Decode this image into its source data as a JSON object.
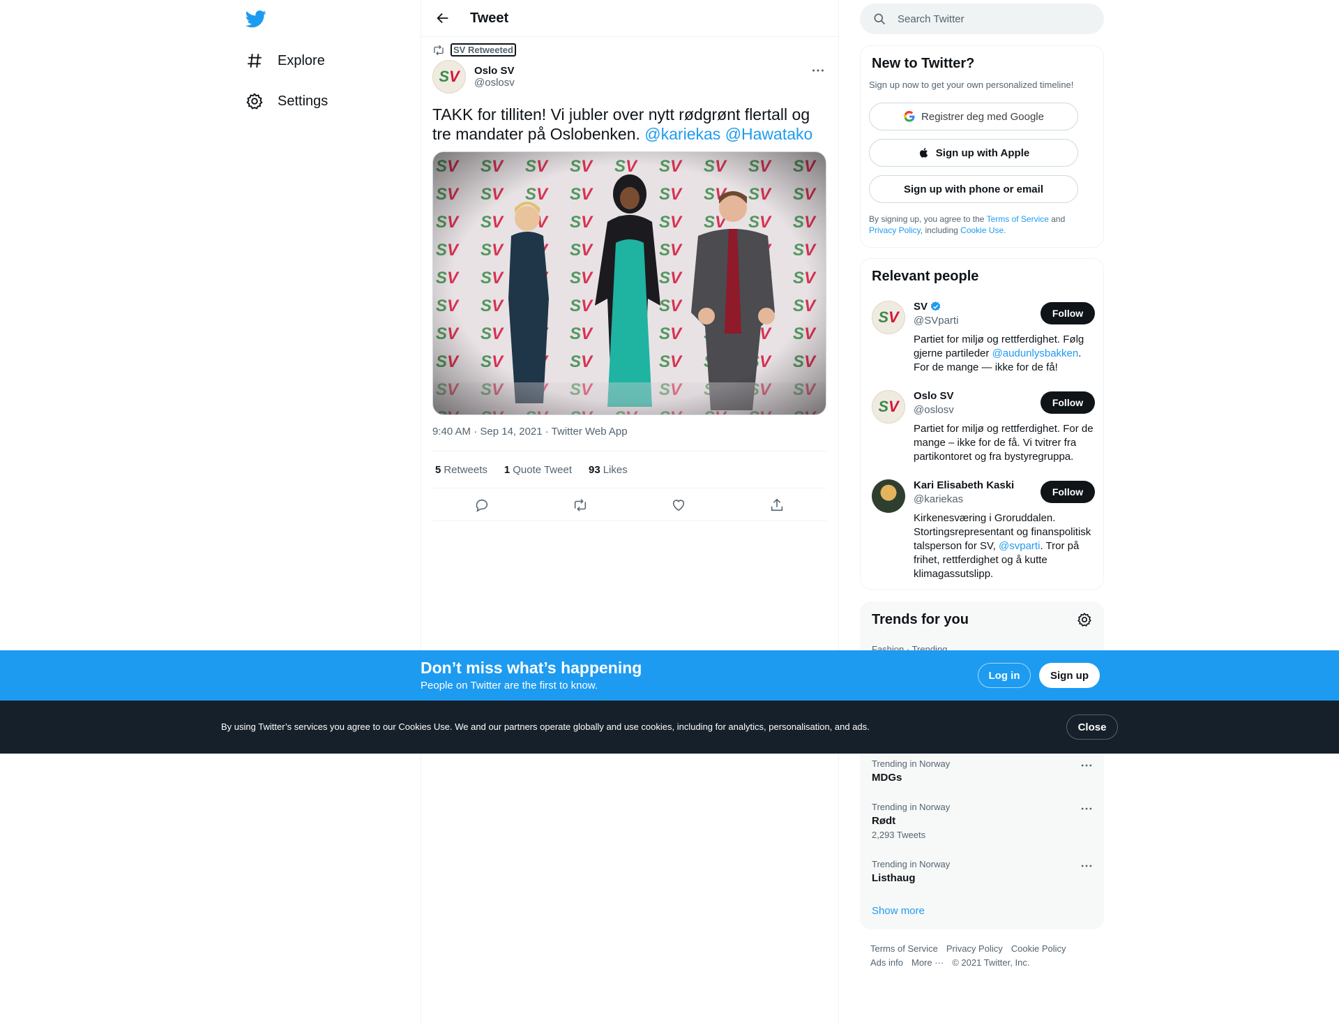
{
  "nav": {
    "explore_label": "Explore",
    "settings_label": "Settings"
  },
  "header": {
    "title": "Tweet"
  },
  "tweet": {
    "retweeted_by": "SV Retweeted",
    "author_name": "Oslo SV",
    "author_handle": "@oslosv",
    "text": "TAKK for tilliten! Vi jubler over nytt rødgrønt flertall og tre mandater på Oslobenken. ",
    "mention_1": "@kariekas",
    "mention_2": "@Hawatako",
    "timestamp": "9:40 AM · Sep 14, 2021 · Twitter Web App",
    "stats": {
      "retweets_count": "5",
      "retweets_label": "Retweets",
      "quotes_count": "1",
      "quotes_label": "Quote Tweet",
      "likes_count": "93",
      "likes_label": "Likes"
    }
  },
  "search": {
    "placeholder": "Search Twitter"
  },
  "new_to_twitter": {
    "title": "New to Twitter?",
    "subtitle": "Sign up now to get your own personalized timeline!",
    "google_label": "Registrer deg med Google",
    "apple_label": "Sign up with Apple",
    "phone_label": "Sign up with phone or email",
    "legal_1": "By signing up, you agree to the ",
    "legal_tos": "Terms of Service",
    "legal_2": " and ",
    "legal_privacy": "Privacy Policy",
    "legal_3": ", including ",
    "legal_cookie": "Cookie Use."
  },
  "relevant_people": {
    "title": "Relevant people",
    "follow_label": "Follow",
    "people": [
      {
        "name": "SV",
        "handle": "@SVparti",
        "bio_1": "Partiet for miljø og rettferdighet. Følg gjerne partileder ",
        "bio_link": "@audunlysbakken",
        "bio_2": ". For de mange — ikke for de få!"
      },
      {
        "name": "Oslo SV",
        "handle": "@oslosv",
        "bio_1": "Partiet for miljø og rettferdighet. For de mange – ikke for de få. Vi tvitrer fra partikontoret og fra bystyregruppa."
      },
      {
        "name": "Kari Elisabeth Kaski",
        "handle": "@kariekas",
        "bio_1": "Kirkenesværing i Groruddalen. Stortingsrepresentant og finanspolitisk talsperson for SV, ",
        "bio_link": "@svparti",
        "bio_2": ". Tror på frihet, rettferdighet og å kutte klimagassutslipp."
      }
    ]
  },
  "trends": {
    "title": "Trends for you",
    "first_context": "Fashion · Trending",
    "items": [
      {
        "context": "Trending in Norway",
        "name": "MDGs"
      },
      {
        "context": "Trending in Norway",
        "name": "Rødt",
        "count": "2,293 Tweets"
      },
      {
        "context": "Trending in Norway",
        "name": "Listhaug"
      }
    ],
    "show_more": "Show more"
  },
  "footer": {
    "tos": "Terms of Service",
    "privacy": "Privacy Policy",
    "cookie": "Cookie Policy",
    "ads": "Ads info",
    "more": "More ···",
    "copyright": "© 2021 Twitter, Inc."
  },
  "signup_bar": {
    "heading": "Don’t miss what’s happening",
    "subheading": "People on Twitter are the first to know.",
    "login_label": "Log in",
    "signup_label": "Sign up"
  },
  "cookie_bar": {
    "text": "By using Twitter’s services you agree to our Cookies Use. We and our partners operate globally and use cookies, including for analytics, personalisation, and ads.",
    "close_label": "Close"
  },
  "colors": {
    "accent": "#1d9bf0",
    "text": "#0f1419",
    "muted": "#536471",
    "cookie_bar": "#15202b"
  }
}
